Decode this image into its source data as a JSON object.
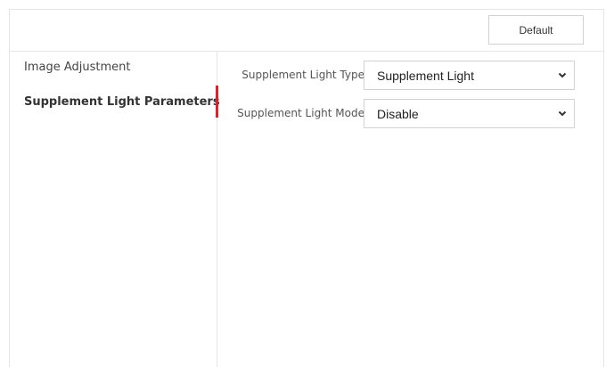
{
  "toolbar": {
    "default_label": "Default"
  },
  "sidebar": {
    "items": [
      {
        "label": "Image Adjustment",
        "active": false
      },
      {
        "label": "Supplement Light Parameters",
        "active": true
      }
    ],
    "accent_color": "#d9232e"
  },
  "form": {
    "fields": [
      {
        "label": "Supplement Light Type",
        "value": "Supplement Light",
        "icon": "chevron-down-icon"
      },
      {
        "label": "Supplement Light Mode",
        "value": "Disable",
        "icon": "chevron-down-icon"
      }
    ]
  }
}
